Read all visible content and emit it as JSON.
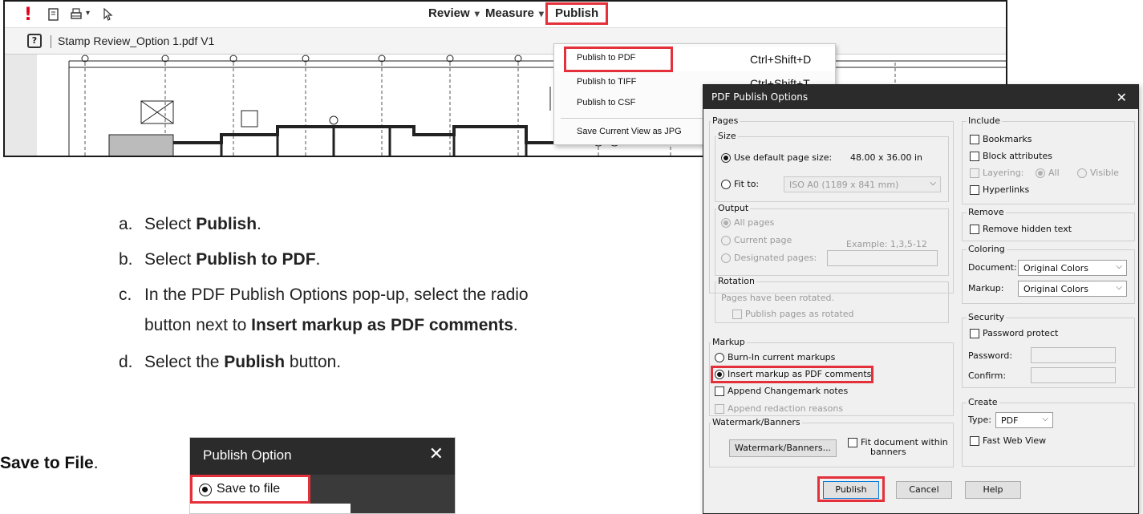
{
  "toolbar": {
    "alert_glyph": "!",
    "menus": [
      {
        "label": "Review",
        "caret": "▾"
      },
      {
        "label": "Measure",
        "caret": "▾"
      },
      {
        "label": "Publish"
      }
    ],
    "doc_title": "Stamp Review_Option 1.pdf V1",
    "help_glyph": "?"
  },
  "publish_menu": {
    "items": [
      {
        "label": "Publish to PDF",
        "shortcut": "Ctrl+Shift+D"
      },
      {
        "label": "Publish to TIFF",
        "shortcut": "Ctrl+Shift+T"
      },
      {
        "label": "Publish to CSF",
        "shortcut": ""
      },
      {
        "label": "Save Current View as JPG",
        "shortcut": ""
      }
    ]
  },
  "steps": [
    {
      "letter": "a.",
      "pre": "Select ",
      "bold": "Publish",
      "post": "."
    },
    {
      "letter": "b.",
      "pre": "Select ",
      "bold": "Publish to PDF",
      "post": "."
    },
    {
      "letter": "c.",
      "pre": "In the PDF Publish Options pop-up, select the radio",
      "bold": "",
      "post": ""
    },
    {
      "letter": "",
      "pre": "button next to ",
      "bold": "Insert markup as PDF comments",
      "post": "."
    },
    {
      "letter": "d.",
      "pre": "Select the ",
      "bold": "Publish",
      "post": " button."
    }
  ],
  "save_text": {
    "bold": "Save to File",
    "post": "."
  },
  "publish_option_dialog": {
    "title": "Publish Option",
    "close": "✕",
    "option": "Save to file"
  },
  "pdf_dialog": {
    "title": "PDF Publish Options",
    "close": "✕",
    "pages": {
      "label": "Pages",
      "size_label": "Size",
      "use_default": "Use default page size:",
      "default_size": "48.00 x 36.00 in",
      "fit_to": "Fit to:",
      "fit_value": "ISO A0 (1189 x 841 mm)"
    },
    "output": {
      "label": "Output",
      "all": "All pages",
      "current": "Current page",
      "designated": "Designated pages:",
      "example": "Example: 1,3,5-12"
    },
    "rotation": {
      "label": "Rotation",
      "note": "Pages have been rotated.",
      "publish_rotated": "Publish pages as rotated"
    },
    "markup": {
      "label": "Markup",
      "burn_in": "Burn-In current markups",
      "insert": "Insert markup as PDF comments",
      "append_changemark": "Append Changemark notes",
      "append_redaction": "Append redaction reasons"
    },
    "watermark": {
      "label": "Watermark/Banners",
      "button": "Watermark/Banners...",
      "fit_line1": "Fit document within",
      "fit_line2": "banners"
    },
    "include": {
      "label": "Include",
      "bookmarks": "Bookmarks",
      "block": "Block attributes",
      "layering": "Layering:",
      "all": "All",
      "visible": "Visible",
      "hyperlinks": "Hyperlinks"
    },
    "remove": {
      "label": "Remove",
      "hidden": "Remove hidden text"
    },
    "coloring": {
      "label": "Coloring",
      "document": "Document:",
      "document_value": "Original Colors",
      "markup": "Markup:",
      "markup_value": "Original Colors"
    },
    "security": {
      "label": "Security",
      "password_protect": "Password protect",
      "password": "Password:",
      "confirm": "Confirm:"
    },
    "create": {
      "label": "Create",
      "type": "Type:",
      "type_value": "PDF",
      "fast_web": "Fast Web View"
    },
    "buttons": {
      "publish": "Publish",
      "cancel": "Cancel",
      "help": "Help"
    }
  },
  "colors": {
    "highlight": "#e4303a",
    "title_bar": "#2b2b2b",
    "alert": "#e3001b"
  }
}
